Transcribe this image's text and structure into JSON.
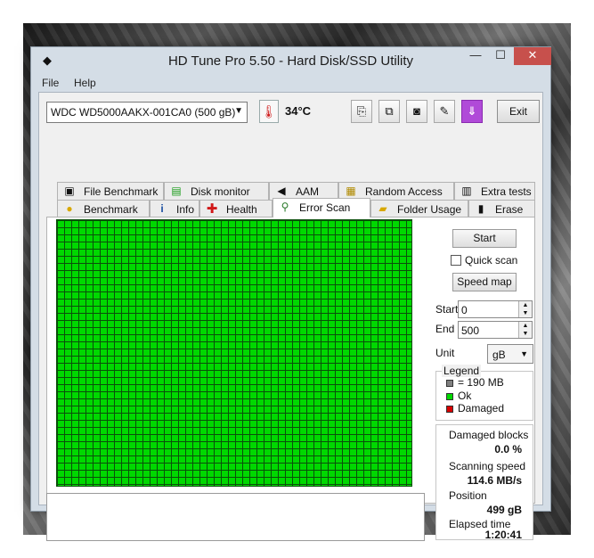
{
  "window": {
    "title": "HD Tune Pro 5.50 - Hard Disk/SSD Utility",
    "controls": {
      "minimize": "—",
      "maximize": "☐",
      "close": "✕"
    }
  },
  "menu": [
    "File",
    "Help"
  ],
  "toolbar": {
    "drive": "WDC WD5000AAKX-001CA0 (500 gB)",
    "temperature": "34°C",
    "buttons": [
      "copy-info-icon",
      "copy-text-icon",
      "screenshot-camera-icon",
      "options-icon",
      "download-icon"
    ],
    "exit_label": "Exit"
  },
  "tabs": {
    "top_row": [
      {
        "label": "File Benchmark",
        "icon": "file-benchmark-icon"
      },
      {
        "label": "Disk monitor",
        "icon": "disk-monitor-icon"
      },
      {
        "label": "AAM",
        "icon": "speaker-icon"
      },
      {
        "label": "Random Access",
        "icon": "random-access-icon"
      },
      {
        "label": "Extra tests",
        "icon": "extra-tests-icon"
      }
    ],
    "bottom_row": [
      {
        "label": "Benchmark",
        "icon": "lightbulb-icon"
      },
      {
        "label": "Info",
        "icon": "info-icon"
      },
      {
        "label": "Health",
        "icon": "health-cross-icon"
      },
      {
        "label": "Error Scan",
        "icon": "magnifier-icon",
        "active": true
      },
      {
        "label": "Folder Usage",
        "icon": "folder-icon"
      },
      {
        "label": "Erase",
        "icon": "trash-icon"
      }
    ]
  },
  "error_scan": {
    "start_button": "Start",
    "quick_scan_label": "Quick scan",
    "quick_scan_checked": false,
    "speed_map_button": "Speed map",
    "start_label": "Start",
    "start_value": "0",
    "end_label": "End",
    "end_value": "500",
    "unit_label": "Unit",
    "unit_value": "gB",
    "legend": {
      "title": "Legend",
      "items": [
        {
          "label": "= 190 MB",
          "color": "#808080"
        },
        {
          "label": "Ok",
          "color": "#00d800"
        },
        {
          "label": "Damaged",
          "color": "#d80000"
        }
      ]
    },
    "stats": {
      "damaged_blocks_label": "Damaged blocks",
      "damaged_blocks_value": "0.0 %",
      "scanning_speed_label": "Scanning speed",
      "scanning_speed_value": "114.6 MB/s",
      "position_label": "Position",
      "position_value": "499 gB",
      "elapsed_time_label": "Elapsed time",
      "elapsed_time_value": "1:20:41"
    },
    "block_color_ok": "#00d800",
    "grid_line_color": "#0b4f0b"
  }
}
